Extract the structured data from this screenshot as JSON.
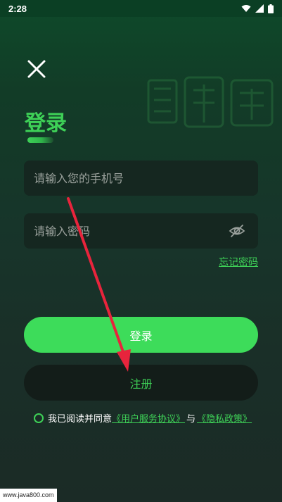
{
  "status_bar": {
    "time": "2:28",
    "icons": [
      "wifi-icon",
      "signal-icon",
      "battery-icon"
    ]
  },
  "brand": {
    "watermark_icon": "app-logo-watermark"
  },
  "header": {
    "close_icon": "close-icon",
    "title": "登录"
  },
  "form": {
    "phone": {
      "placeholder": "请输入您的手机号",
      "value": ""
    },
    "password": {
      "placeholder": "请输入密码",
      "value": "",
      "toggle_icon": "eye-off-icon"
    },
    "forgot_label": "忘记密码"
  },
  "actions": {
    "login_label": "登录",
    "register_label": "注册"
  },
  "agreement": {
    "prefix": "我已阅读并同意",
    "user_agreement": "《用户服务协议》",
    "separator": "与",
    "privacy_policy": "《隐私政策》",
    "checked": false
  },
  "footer": {
    "site_watermark": "www.java800.com"
  },
  "colors": {
    "accent": "#3ed157",
    "button": "#3ddc5a",
    "annotation": "#e8243c"
  }
}
